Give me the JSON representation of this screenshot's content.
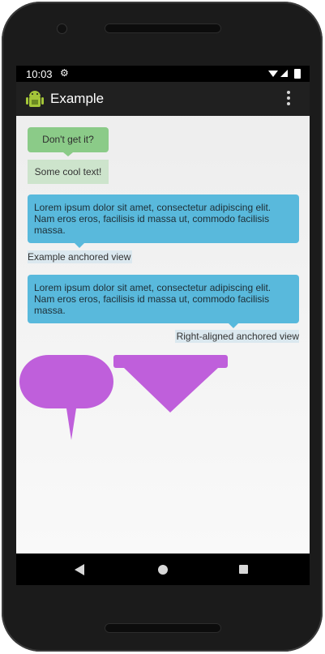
{
  "status_bar": {
    "time": "10:03",
    "settings_glyph": "⚙"
  },
  "app_bar": {
    "title": "Example",
    "icon": "android-robot-icon",
    "menu_icon": "overflow-menu-icon"
  },
  "content": {
    "tooltip_small": "Don't get it?",
    "cool_text": "Some cool text!",
    "tooltip_long_1": "Lorem ipsum dolor sit amet, consectetur adipiscing elit. Nam eros eros, facilisis id massa ut, commodo facilisis massa.",
    "anchor_label_1": "Example anchored view",
    "tooltip_long_2": "Lorem ipsum dolor sit amet, consectetur adipiscing elit. Nam eros eros, facilisis id massa ut, commodo facilisis massa.",
    "anchor_label_2": "Right-aligned anchored view",
    "shape_color": "#bf5fdb"
  },
  "nav_bar": {
    "back": "back-icon",
    "home": "home-icon",
    "recents": "recents-icon"
  },
  "colors": {
    "green_tooltip": "#8bcb88",
    "blue_tooltip": "#59b9dc",
    "purple_shape": "#bf5fdb"
  }
}
